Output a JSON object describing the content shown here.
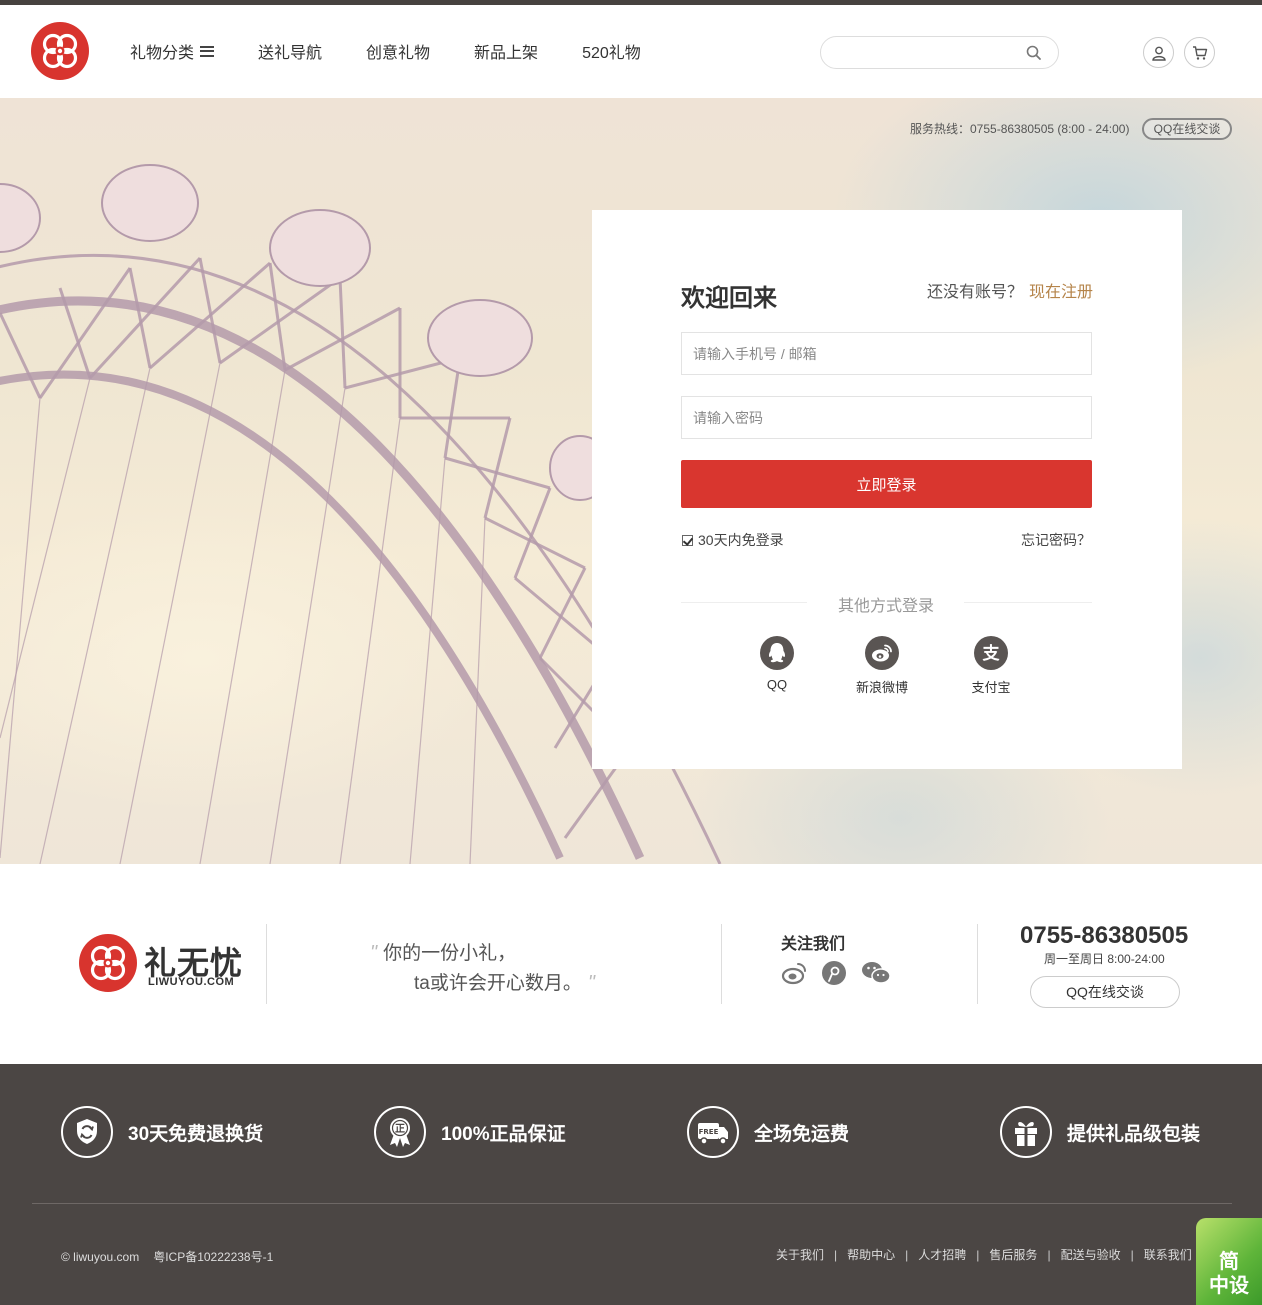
{
  "header": {
    "nav": [
      {
        "label": "礼物分类"
      },
      {
        "label": "送礼导航"
      },
      {
        "label": "创意礼物"
      },
      {
        "label": "新品上架"
      },
      {
        "label": "520礼物"
      }
    ],
    "search_placeholder": ""
  },
  "hero": {
    "hotline": "服务热线：0755-86380505 (8:00 - 24:00)",
    "qq_button": "QQ在线交谈"
  },
  "login": {
    "title": "欢迎回来",
    "no_account": "还没有账号？",
    "register_link": "现在注册",
    "phone_placeholder": "请输入手机号 / 邮箱",
    "password_placeholder": "请输入密码",
    "submit": "立即登录",
    "remember": "30天内免登录",
    "forgot": "忘记密码？",
    "other_methods": "其他方式登录",
    "socials": [
      {
        "label": "QQ",
        "icon": "qq-icon"
      },
      {
        "label": "新浪微博",
        "icon": "weibo-icon"
      },
      {
        "label": "支付宝",
        "icon": "alipay-icon"
      }
    ]
  },
  "footer": {
    "brand": "礼无忧",
    "brand_sub": "LIWUYOU.COM",
    "slogan_line1": "你的一份小礼，",
    "slogan_line2": "ta或许会开心数月。",
    "follow_title": "关注我们",
    "phone": "0755-86380505",
    "hours": "周一至周日 8:00-24:00",
    "qq_button": "QQ在线交谈",
    "features": [
      {
        "label": "30天免费退换货",
        "icon": "shield-return-icon"
      },
      {
        "label": "100%正品保证",
        "icon": "genuine-medal-icon"
      },
      {
        "label": "全场免运费",
        "icon": "free-delivery-truck-icon"
      },
      {
        "label": "提供礼品级包装",
        "icon": "gift-box-icon"
      }
    ],
    "copyright": "© liwuyou.com",
    "icp": "粤ICP备10222238号-1",
    "links": [
      "关于我们",
      "帮助中心",
      "人才招聘",
      "售后服务",
      "配送与验收",
      "联系我们"
    ],
    "badge_line1": "简",
    "badge_line2": "中设"
  },
  "colors": {
    "brand_red": "#d8342e",
    "accent_gold": "#b5844a",
    "footer_dark": "#4b4644"
  }
}
